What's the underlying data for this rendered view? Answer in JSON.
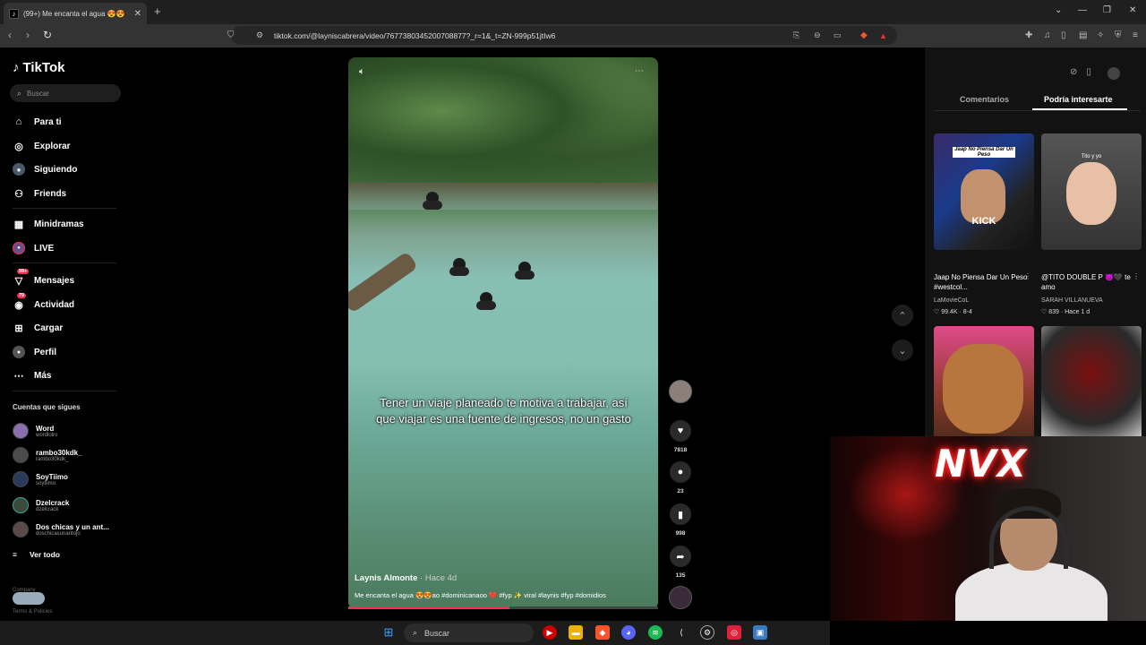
{
  "browser": {
    "tab_title": "(99+) Me encanta el agua 😍😍",
    "tab_close": "✕",
    "new_tab": "+",
    "url": "tiktok.com/@layniscabrera/video/7677380345200708877?_r=1&_t=ZN-999p51jtIw6"
  },
  "sidebar": {
    "logo": "TikTok",
    "search_placeholder": "Buscar",
    "nav": [
      {
        "label": "Para ti",
        "icon": "home-icon"
      },
      {
        "label": "Explorar",
        "icon": "compass-icon"
      },
      {
        "label": "Siguiendo",
        "icon": "following-icon"
      },
      {
        "label": "Friends",
        "icon": "friends-icon"
      },
      {
        "label": "Minidramas",
        "icon": "film-icon"
      },
      {
        "label": "LIVE",
        "icon": "live-icon"
      },
      {
        "label": "Mensajes",
        "icon": "message-icon",
        "badge": "99+"
      },
      {
        "label": "Actividad",
        "icon": "activity-icon",
        "badge": "79"
      },
      {
        "label": "Cargar",
        "icon": "upload-icon"
      },
      {
        "label": "Perfil",
        "icon": "profile-icon"
      },
      {
        "label": "Más",
        "icon": "more-icon"
      }
    ],
    "following_title": "Cuentas que sigues",
    "accounts": [
      {
        "name": "Word",
        "handle": "wordlolro"
      },
      {
        "name": "rambo30kdk_",
        "handle": "rambo30kdk_"
      },
      {
        "name": "SoyTiimo",
        "handle": "soytiimo"
      },
      {
        "name": "Dzelcrack",
        "handle": "dzelcrack"
      },
      {
        "name": "Dos chicas y un ant...",
        "handle": "doschicasunantojo"
      }
    ],
    "see_all": "Ver todo",
    "footer_lines": [
      "Company",
      "Program",
      "Terms & Policies"
    ]
  },
  "video": {
    "caption": "Tener un viaje planeado te motiva a trabajar, así que viajar es una fuente de ingresos, no un gasto",
    "author": "Laynis Almonte",
    "time": " · Hace 4d",
    "description": "Me encanta el agua 😍😍ao #dominicanaoo ❤️ #fyp ✨ viral #laynis #fyp #domidios",
    "progress": 0.52
  },
  "actions": {
    "likes": "7818",
    "comments": "23",
    "saves": "998",
    "shares": "135"
  },
  "right_panel": {
    "tabs": [
      "Comentarios",
      "Podría interesarte"
    ],
    "cards": [
      {
        "thumb_text": "Jaap No Piensa Dar Un Peso",
        "thumb_sub": "KICK",
        "title": "Jaap No Piensa Dar Un Peso #westcol...",
        "author": "LaMovieCoL",
        "meta": "♡ 99.4K · 8-4"
      },
      {
        "thumb_text": "Tito y yo",
        "title": "@TITO DOUBLE P 😈🖤 te amo",
        "author": "SARAH VILLANUEVA",
        "meta": "♡ 839 · Hace 1 d"
      },
      {
        "thumb_text": "",
        "title": "",
        "author": "",
        "meta": ""
      },
      {
        "thumb_text": "",
        "title": "",
        "author": "",
        "meta": ""
      }
    ]
  },
  "webcam": {
    "sign": "NVX"
  },
  "taskbar": {
    "search": "Buscar"
  },
  "colors": {
    "accent": "#fe2c55",
    "background": "#000000",
    "panel": "#121212",
    "neon": "#ff2a2a"
  }
}
